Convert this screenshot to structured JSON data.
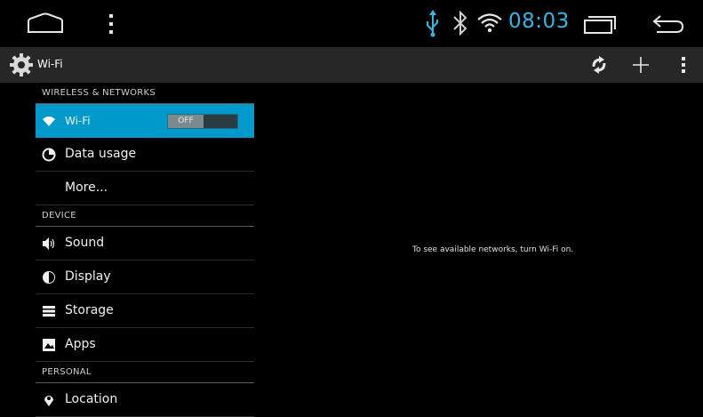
{
  "status_bar": {
    "time": "08:03",
    "icons": [
      "home-icon",
      "menu-icon",
      "usb-icon",
      "bluetooth-icon",
      "wifi-signal-icon",
      "recent-apps-icon",
      "back-icon"
    ]
  },
  "action_bar": {
    "title": "Wi-Fi",
    "icons": [
      "settings-gear-icon",
      "refresh-icon",
      "add-icon",
      "overflow-menu-icon"
    ]
  },
  "sidebar": {
    "sections": [
      {
        "header": "WIRELESS & NETWORKS",
        "items": [
          {
            "label": "Wi-Fi",
            "icon": "wifi-icon",
            "selected": true,
            "toggle": "OFF"
          },
          {
            "label": "Data usage",
            "icon": "data-usage-icon"
          },
          {
            "label": "More...",
            "icon": ""
          }
        ]
      },
      {
        "header": "DEVICE",
        "items": [
          {
            "label": "Sound",
            "icon": "sound-icon"
          },
          {
            "label": "Display",
            "icon": "display-icon"
          },
          {
            "label": "Storage",
            "icon": "storage-icon"
          },
          {
            "label": "Apps",
            "icon": "apps-icon"
          }
        ]
      },
      {
        "header": "PERSONAL",
        "items": [
          {
            "label": "Location",
            "icon": "location-icon"
          }
        ]
      }
    ]
  },
  "main": {
    "message": "To see available networks, turn Wi-Fi on."
  },
  "colors": {
    "accent": "#33b5e5",
    "selected": "#0099cc",
    "actionbar": "#272727"
  }
}
